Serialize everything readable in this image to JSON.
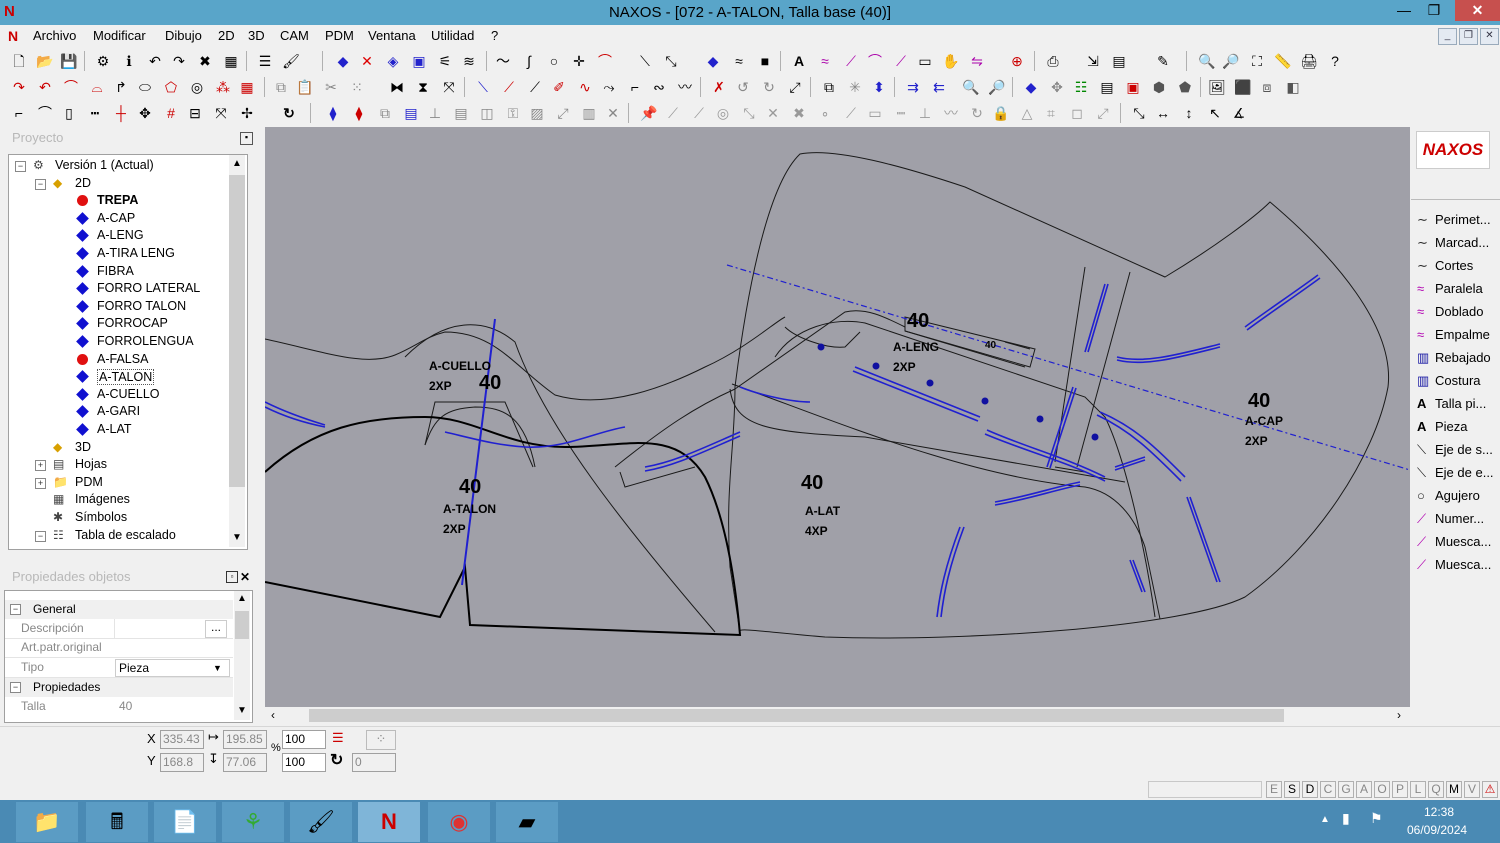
{
  "window": {
    "title": "NAXOS - [072 - A-TALON, Talla base (40)]",
    "logo": "N",
    "controls": {
      "minimize": "—",
      "maximize": "❐",
      "close": "✕"
    }
  },
  "menu": [
    "Archivo",
    "Modificar",
    "Dibujo",
    "2D",
    "3D",
    "CAM",
    "PDM",
    "Ventana",
    "Utilidad",
    "?"
  ],
  "mdi_controls": {
    "minimize": "_",
    "restore": "❐",
    "close": "✕"
  },
  "project_panel": {
    "title": "Proyecto",
    "tree": [
      {
        "label": "Versión 1 (Actual)",
        "level": 0,
        "icon": "version-icon",
        "expander": "−"
      },
      {
        "label": "2D",
        "level": 1,
        "icon": "folder-2d-icon",
        "expander": "−"
      },
      {
        "label": "TREPA",
        "level": 2,
        "icon": "red-dot-icon",
        "bold": true
      },
      {
        "label": "A-CAP",
        "level": 2,
        "icon": "blue-diamond-icon"
      },
      {
        "label": "A-LENG",
        "level": 2,
        "icon": "blue-diamond-icon"
      },
      {
        "label": "A-TIRA LENG",
        "level": 2,
        "icon": "blue-diamond-icon"
      },
      {
        "label": "FIBRA",
        "level": 2,
        "icon": "blue-diamond-icon"
      },
      {
        "label": "FORRO LATERAL",
        "level": 2,
        "icon": "blue-diamond-icon"
      },
      {
        "label": "FORRO TALON",
        "level": 2,
        "icon": "blue-diamond-icon"
      },
      {
        "label": "FORROCAP",
        "level": 2,
        "icon": "blue-diamond-icon"
      },
      {
        "label": "FORROLENGUA",
        "level": 2,
        "icon": "blue-diamond-icon"
      },
      {
        "label": "A-FALSA",
        "level": 2,
        "icon": "red-dot-icon"
      },
      {
        "label": "A-TALON",
        "level": 2,
        "icon": "blue-diamond-icon",
        "selected": true
      },
      {
        "label": "A-CUELLO",
        "level": 2,
        "icon": "blue-diamond-icon"
      },
      {
        "label": "A-GARI",
        "level": 2,
        "icon": "blue-diamond-icon"
      },
      {
        "label": "A-LAT",
        "level": 2,
        "icon": "blue-diamond-icon"
      },
      {
        "label": "3D",
        "level": 1,
        "icon": "folder-3d-icon"
      },
      {
        "label": "Hojas",
        "level": 1,
        "icon": "sheets-icon",
        "expander": "+"
      },
      {
        "label": "PDM",
        "level": 1,
        "icon": "pdm-folder-icon",
        "expander": "+"
      },
      {
        "label": "Imágenes",
        "level": 1,
        "icon": "images-icon"
      },
      {
        "label": "Símbolos",
        "level": 1,
        "icon": "symbols-icon"
      },
      {
        "label": "Tabla de escalado",
        "level": 1,
        "icon": "table-icon",
        "expander": "−"
      }
    ]
  },
  "properties_panel": {
    "title": "Propiedades objetos",
    "sections": [
      {
        "name": "General",
        "rows": [
          {
            "label": "Descripción",
            "value": "",
            "button": "..."
          },
          {
            "label": "Art.patr.original",
            "value": ""
          },
          {
            "label": "Tipo",
            "value": "Pieza",
            "dropdown": true
          }
        ]
      },
      {
        "name": "Propiedades",
        "rows": [
          {
            "label": "Talla",
            "value": "40"
          }
        ]
      }
    ]
  },
  "canvas": {
    "labels": [
      {
        "text": "A-CUELLO",
        "size": "2XP",
        "talla": "40"
      },
      {
        "text": "A-TALON",
        "size": "2XP",
        "talla": "40"
      },
      {
        "text": "A-LENG",
        "size": "2XP",
        "talla": "40"
      },
      {
        "text": "A-LAT",
        "size": "4XP",
        "talla": "40"
      },
      {
        "text": "A-CAP",
        "size": "2XP",
        "talla": "40"
      }
    ],
    "mark_small": "40"
  },
  "palette": {
    "logo": "NAXOS",
    "items": [
      {
        "label": "Perimet...",
        "icon": "curve-icon"
      },
      {
        "label": "Marcad...",
        "icon": "curve-icon"
      },
      {
        "label": "Cortes",
        "icon": "curve-icon"
      },
      {
        "label": "Paralela",
        "icon": "parallel-icon"
      },
      {
        "label": "Doblado",
        "icon": "fold-icon"
      },
      {
        "label": "Empalme",
        "icon": "join-icon"
      },
      {
        "label": "Rebajado",
        "icon": "skive-icon"
      },
      {
        "label": "Costura",
        "icon": "seam-icon"
      },
      {
        "label": "Talla pi...",
        "icon": "text-a-icon"
      },
      {
        "label": "Pieza",
        "icon": "text-a-icon"
      },
      {
        "label": "Eje de s...",
        "icon": "axis-icon"
      },
      {
        "label": "Eje de e...",
        "icon": "axis-icon"
      },
      {
        "label": "Agujero",
        "icon": "circle-icon"
      },
      {
        "label": "Numer...",
        "icon": "pen-icon"
      },
      {
        "label": "Muesca...",
        "icon": "pen-icon"
      },
      {
        "label": "Muesca...",
        "icon": "pen-icon"
      }
    ]
  },
  "coords": {
    "x_label": "X",
    "x": "335.43",
    "width": "195.85",
    "scale_x": "100",
    "y_label": "Y",
    "y": "168.8",
    "height": "77.06",
    "scale_y": "100",
    "percent": "%",
    "angle": "0"
  },
  "statusbar": {
    "letters": [
      "E",
      "S",
      "D",
      "C",
      "G",
      "A",
      "O",
      "P",
      "L",
      "Q",
      "M",
      "V"
    ]
  },
  "taskbar": {
    "time": "12:38",
    "date": "06/09/2024",
    "apps": [
      "explorer-icon",
      "calculator-icon",
      "documents-icon",
      "leaf-app-icon",
      "paint-icon",
      "naxos-icon",
      "chrome-icon",
      "notes-icon"
    ]
  },
  "colors": {
    "titlebar": "#59a5c9",
    "canvas": "#a0a0a8",
    "piece_line": "#1a1a1a",
    "mark_line": "#2020d0",
    "taskbar": "#4a8ab4"
  }
}
